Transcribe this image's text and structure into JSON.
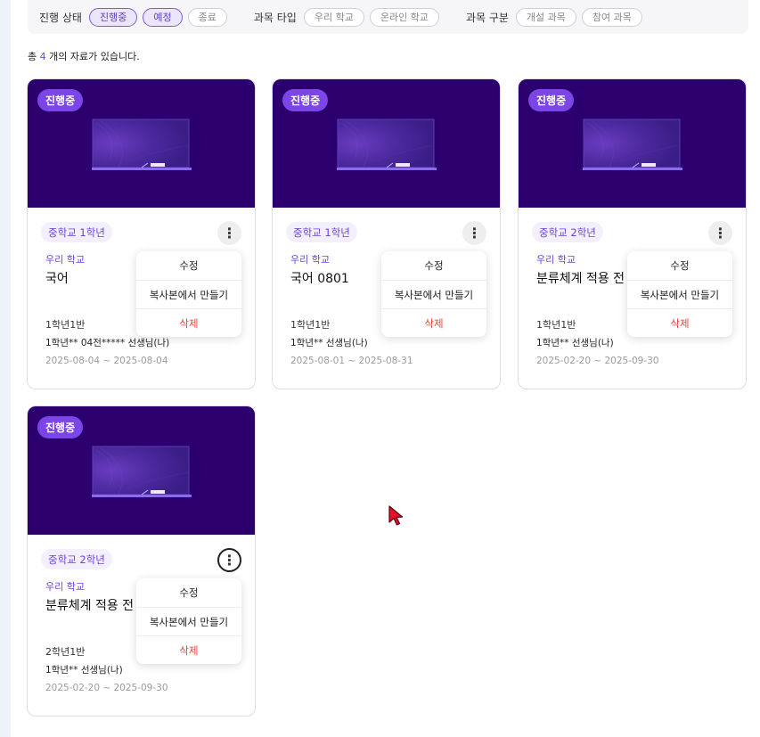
{
  "filters": {
    "status": {
      "label": "진행 상태",
      "options": [
        {
          "label": "진행중"
        },
        {
          "label": "예정"
        },
        {
          "label": "종료"
        }
      ]
    },
    "type": {
      "label": "과목 타입",
      "options": [
        {
          "label": "우리 학교"
        },
        {
          "label": "온라인 학교"
        }
      ]
    },
    "category": {
      "label": "과목 구분",
      "options": [
        {
          "label": "개설 과목"
        },
        {
          "label": "참여 과목"
        }
      ]
    }
  },
  "summary": {
    "prefix": "총",
    "count": "4",
    "suffix": "개의 자료가 있습니다."
  },
  "menu": {
    "edit": "수정",
    "copy": "복사본에서 만들기",
    "delete": "삭제"
  },
  "cards": [
    {
      "status": "진행중",
      "grade": "중학교 1학년",
      "school": "우리 학교",
      "title": "국어",
      "class_name": "1학년1반",
      "teacher": "1학년** 04전***** 선생님(나)",
      "period": "2025-08-04 ~ 2025-08-04"
    },
    {
      "status": "진행중",
      "grade": "중학교 1학년",
      "school": "우리 학교",
      "title": "국어 0801",
      "class_name": "1학년1반",
      "teacher": "1학년** 선생님(나)",
      "period": "2025-08-01 ~ 2025-08-31"
    },
    {
      "status": "진행중",
      "grade": "중학교 2학년",
      "school": "우리 학교",
      "title": "분류체계 적용 전 임",
      "class_name": "1학년1반",
      "teacher": "1학년** 선생님(나)",
      "period": "2025-02-20 ~ 2025-09-30"
    },
    {
      "status": "진행중",
      "grade": "중학교 2학년",
      "school": "우리 학교",
      "title": "분류체계 적용 전 임",
      "class_name": "2학년1반",
      "teacher": "1학년** 선생님(나)",
      "period": "2025-02-20 ~ 2025-09-30"
    }
  ],
  "icons": {
    "more": "more-vertical-icon",
    "board": "chalkboard-icon",
    "cursor": "pointer-cursor-icon"
  },
  "colors": {
    "hero": "#2b006e",
    "badge": "#7b45e8",
    "accent": "#6a44e0",
    "danger": "#e8423a"
  }
}
